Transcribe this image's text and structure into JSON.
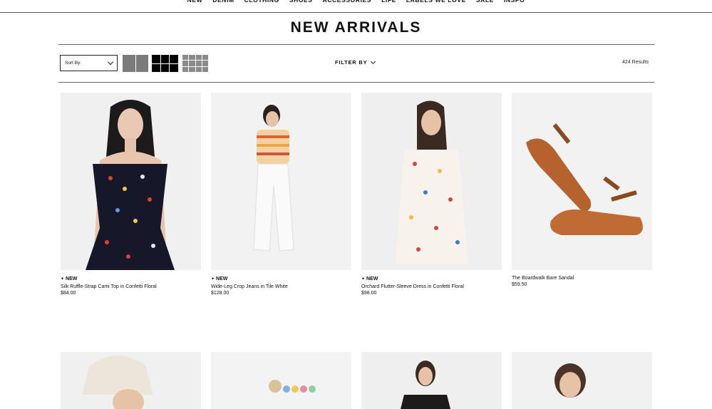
{
  "nav": {
    "items": [
      "NEW",
      "DENIM",
      "CLOTHING",
      "SHOES",
      "ACCESSORIES",
      "LIFE",
      "LABELS WE LOVE",
      "SALE",
      "INSPO"
    ]
  },
  "page": {
    "title": "NEW ARRIVALS"
  },
  "toolbar": {
    "sort_label": "Sort By:",
    "filter_label": "FILTER BY",
    "results": "424 Results"
  },
  "products": [
    {
      "badge": "NEW",
      "name": "Silk Ruffle-Strap Cami Top in Confetti Floral",
      "price": "$84.00"
    },
    {
      "badge": "NEW",
      "name": "Wide-Leg Crop Jeans in Tile White",
      "price": "$128.00"
    },
    {
      "badge": "NEW",
      "name": "Orchard Flutter-Sleeve Dress in Confetti Floral",
      "price": "$98.00"
    },
    {
      "badge": "",
      "name": "The Boardwalk Bare Sandal",
      "price": "$59.50"
    }
  ],
  "colors": {
    "accent": "#111111",
    "image_bg": "#f1f1f1",
    "rule": "#666666"
  }
}
